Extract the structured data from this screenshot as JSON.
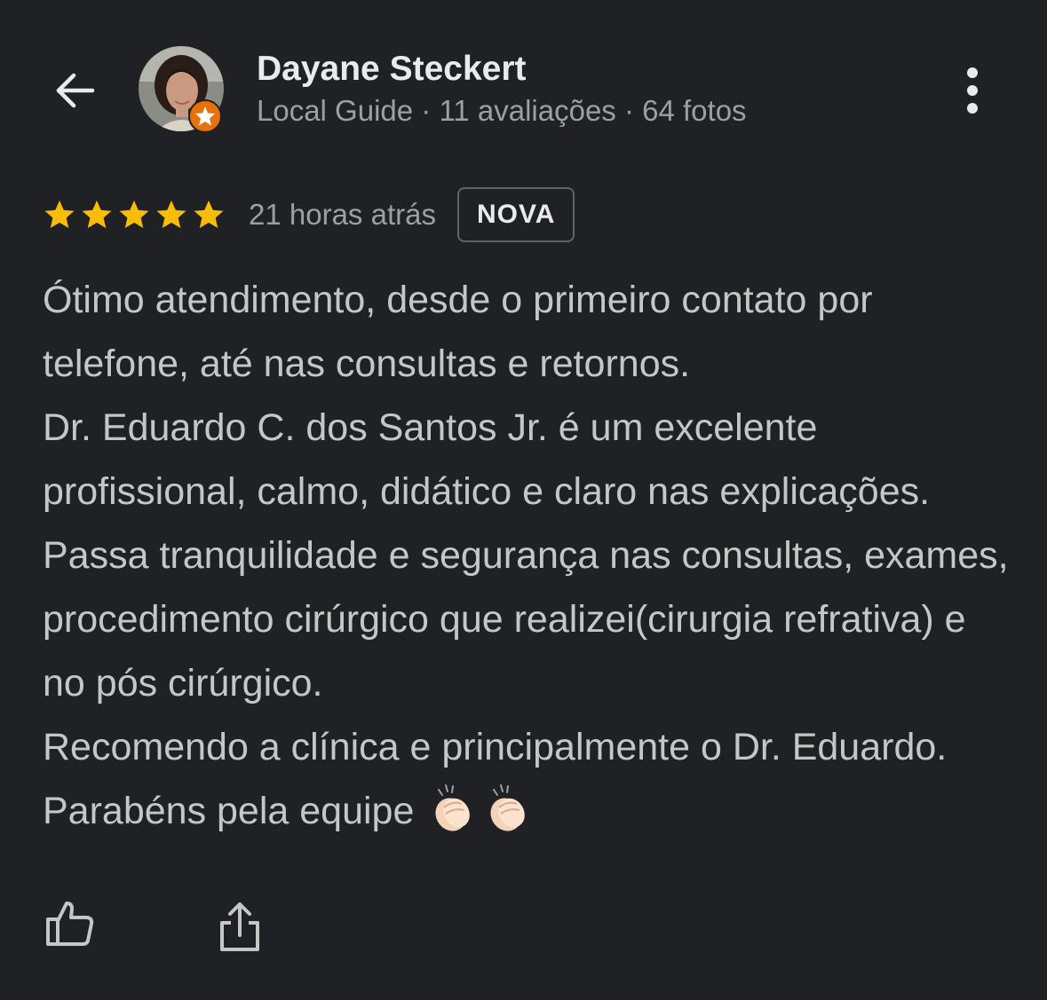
{
  "header": {
    "back_icon": "arrow-back-icon",
    "user_name": "Dayane Steckert",
    "user_meta": "Local Guide · 11 avaliações · 64 fotos",
    "badge_icon": "local-guide-star-icon",
    "more_icon": "more-vertical-icon"
  },
  "review": {
    "stars": 5,
    "max_stars": 5,
    "star_color": "#fbbc04",
    "time": "21 horas atrás",
    "new_badge": "NOVA",
    "paragraph_1": "Ótimo atendimento, desde o primeiro contato por telefone, até nas consultas e retornos.",
    "paragraph_2": "Dr. Eduardo C. dos Santos Jr. é um excelente profissional, calmo, didático e claro nas explicações. Passa tranquilidade e segurança nas consultas, exames, procedimento cirúrgico que realizei(cirurgia refrativa) e no pós cirúrgico.",
    "paragraph_3": "Recomendo a clínica e principalmente o Dr. Eduardo. Parabéns pela equipe",
    "emoji": [
      "clapping-hands",
      "clapping-hands"
    ]
  },
  "actions": {
    "like_icon": "thumbs-up-icon",
    "share_icon": "share-icon"
  },
  "colors": {
    "background": "#202124",
    "primary_text": "#e8eaed",
    "secondary_text": "#9aa0a6",
    "body_text": "#c4c7c5",
    "guide_badge": "#e8710a"
  }
}
